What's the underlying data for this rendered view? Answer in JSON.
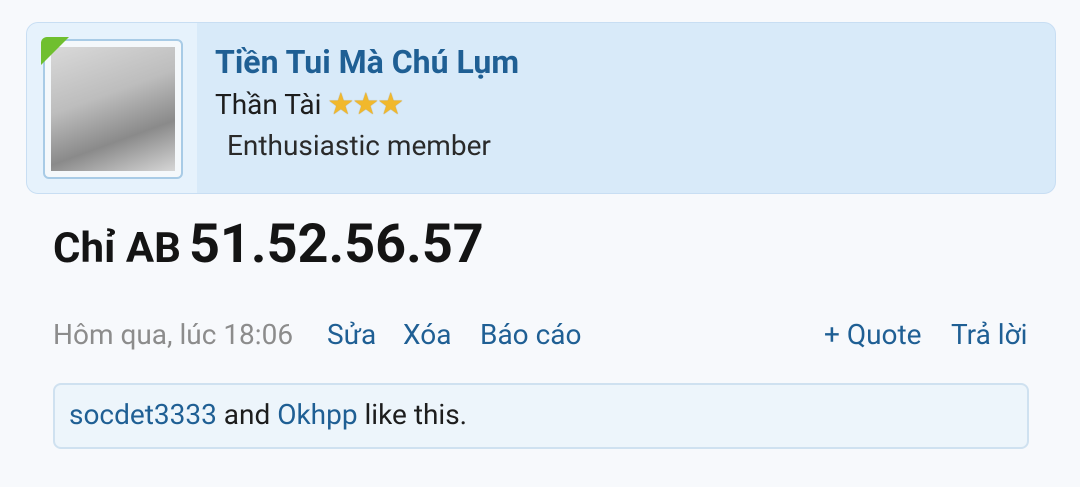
{
  "user": {
    "name": "Tiền Tui Mà Chú Lụm",
    "rank_title": "Thần Tài",
    "stars": "★★★",
    "member_title": "Enthusiastic member"
  },
  "post": {
    "prefix": "Chỉ AB",
    "numbers": "51.52.56.57"
  },
  "meta": {
    "time": "Hôm qua, lúc 18:06",
    "edit": "Sửa",
    "delete": "Xóa",
    "report": "Báo cáo",
    "quote": "+ Quote",
    "reply": "Trả lời"
  },
  "likes": {
    "user1": "socdet3333",
    "joiner": "and",
    "user2": "Okhpp",
    "suffix": "like this."
  },
  "colors": {
    "link": "#1f5f94",
    "card_bg": "#d8eaf9",
    "star": "#f1b82c",
    "flag": "#6fbf2f"
  }
}
